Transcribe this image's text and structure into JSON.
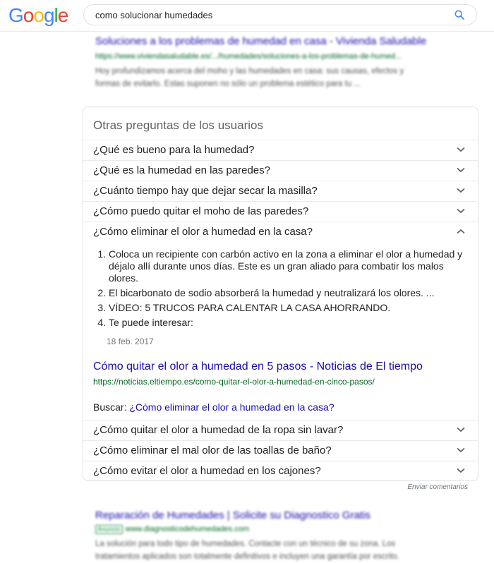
{
  "logo": {
    "letters": [
      "G",
      "o",
      "o",
      "g",
      "l",
      "e"
    ]
  },
  "search": {
    "query": "como solucionar humedades",
    "icon": "search-icon"
  },
  "result_top": {
    "title": "Soluciones a los problemas de humedad en casa - Vivienda Saludable",
    "url": "https://www.viviendasaludable.es/.../humedades/soluciones-a-los-problemas-de-humed...",
    "snippet_lines": [
      "Hoy profundizamos acerca del moho y las humedades en casa: sus causas, efectos y",
      "formas de evitarlo. Estas suponen no sólo un problema estético para tu ..."
    ]
  },
  "paa": {
    "heading": "Otras preguntas de los usuarios",
    "questions_top": [
      "¿Qué es bueno para la humedad?",
      "¿Qué es la humedad en las paredes?",
      "¿Cuánto tiempo hay que dejar secar la masilla?",
      "¿Cómo puedo quitar el moho de las paredes?"
    ],
    "expanded": {
      "question": "¿Cómo eliminar el olor a humedad en la casa?",
      "answer_items": [
        "Coloca un recipiente con carbón activo en la zona a eliminar el olor a humedad y déjalo allí durante unos días. Este es un gran aliado para combatir los malos olores.",
        "El bicarbonato de sodio absorberá la humedad y neutralizará los olores. ...",
        "VÍDEO: 5 TRUCOS PARA CALENTAR LA CASA AHORRANDO.",
        "Te puede interesar:"
      ],
      "date": "18 feb. 2017",
      "source_title": "Cómo quitar el olor a humedad en 5 pasos - Noticias de El tiempo",
      "source_url": "https://noticias.eltiempo.es/como-quitar-el-olor-a-humedad-en-cinco-pasos/",
      "search_label": "Buscar:",
      "search_link": "¿Cómo eliminar el olor a humedad en la casa?"
    },
    "questions_bottom": [
      "¿Cómo quitar el olor a humedad de la ropa sin lavar?",
      "¿Cómo eliminar el mal olor de las toallas de baño?",
      "¿Cómo evitar el olor a humedad en los cajones?"
    ]
  },
  "feedback": "Enviar comentarios",
  "result_ad": {
    "title": "Reparación de Humedades | Solicite su Diagnostico Gratis",
    "badge": "Anuncio",
    "url": "www.diagnosticodehumedades.com",
    "snippet_lines": [
      "La solución para todo tipo de humedades. Contacte con un técnico de su zona. Los",
      "tratamientos aplicados son totalmente definitivos e incluyen una garantía por escrito."
    ]
  },
  "colors": {
    "link": "#1a0dab",
    "url_green": "#006621",
    "google_blue": "#4285f4",
    "google_red": "#ea4335",
    "google_yellow": "#fbbc05",
    "google_green": "#34a853"
  }
}
